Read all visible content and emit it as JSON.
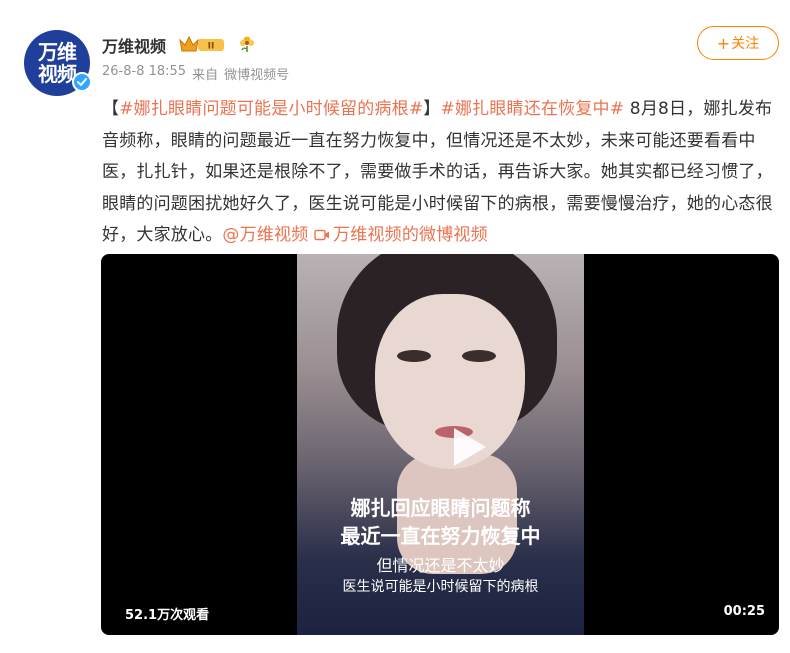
{
  "author": {
    "avatar_line1": "万维",
    "avatar_line2": "视频",
    "name": "万维视频",
    "time": "26-8-8 18:55",
    "source_prefix": "来自",
    "source": "微博视频号",
    "crown_badge_text": "II"
  },
  "follow_button": {
    "plus": "+",
    "label": "关注"
  },
  "post": {
    "open_bracket": "【",
    "topic1": "#娜扎眼睛问题可能是小时候留的病根#",
    "close_bracket": "】",
    "topic2": "#娜扎眼睛还在恢复中#",
    "body": " 8月8日，娜扎发布音频称，眼睛的问题最近一直在努力恢复中，但情况还是不太妙，未来可能还要看看中医，扎扎针，如果还是根除不了，需要做手术的话，再告诉大家。她其实都已经习惯了，眼睛的问题困扰她好久了，医生说可能是小时候留下的病根，需要慢慢治疗，她的心态很好，大家放心。",
    "mention": "@万维视频",
    "video_link": "万维视频的微博视频"
  },
  "video": {
    "caption1": "娜扎回应眼睛问题称",
    "caption2": "最近一直在努力恢复中",
    "caption3": "但情况还是不太妙",
    "caption4": "医生说可能是小时候留下的病根",
    "views": "52.1万次观看",
    "duration": "00:25"
  },
  "colors": {
    "accent": "#ff8200",
    "link": "#eb7350",
    "avatar_bg": "#1f3f9a",
    "verified": "#2fa6ff"
  },
  "icons": [
    "verified-icon",
    "crown-badge-icon",
    "flower-badge-icon",
    "video-link-icon",
    "play-icon"
  ]
}
